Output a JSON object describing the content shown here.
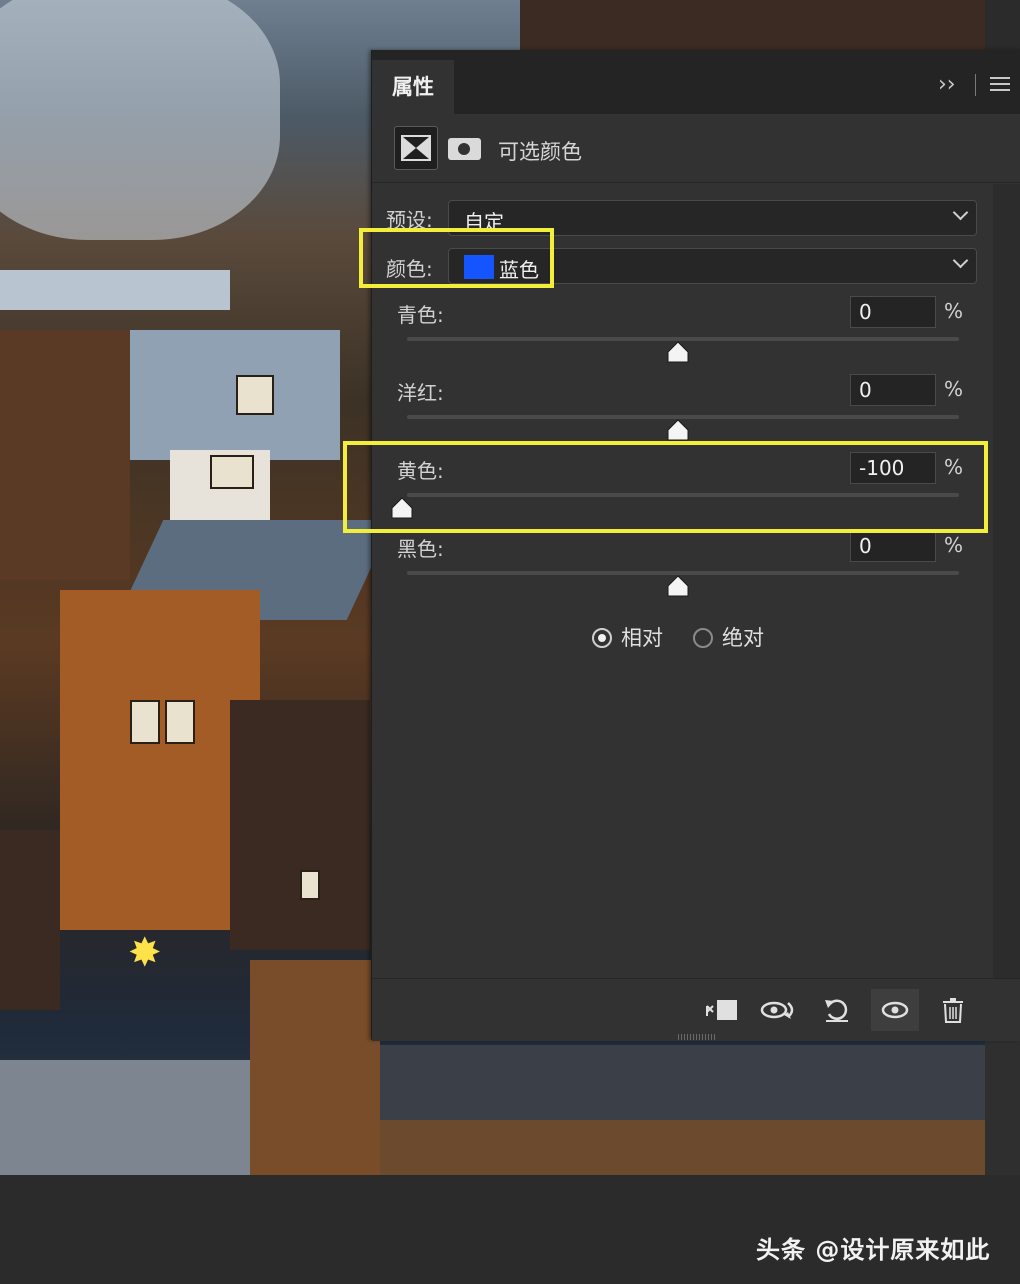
{
  "panel": {
    "tab_label": "属性",
    "expand_glyph": "››",
    "adjustment_title": "可选颜色",
    "preset": {
      "label": "预设:",
      "value": "自定"
    },
    "colors": {
      "label": "颜色:",
      "value": "蓝色",
      "swatch_color": "#1455ff"
    },
    "sliders": [
      {
        "label": "青色:",
        "value": "0",
        "unit": "%",
        "percent": 0
      },
      {
        "label": "洋红:",
        "value": "0",
        "unit": "%",
        "percent": 0
      },
      {
        "label": "黄色:",
        "value": "-100",
        "unit": "%",
        "percent": -100
      },
      {
        "label": "黑色:",
        "value": "0",
        "unit": "%",
        "percent": 0
      }
    ],
    "method": {
      "relative_label": "相对",
      "absolute_label": "绝对",
      "selected": "relative"
    },
    "footer_icons": [
      "clip-to-layer-icon",
      "view-previous-state-icon",
      "reset-icon",
      "visibility-icon",
      "delete-icon"
    ]
  },
  "highlight_color": "#f3ee3a",
  "watermark": "头条 @设计原来如此"
}
